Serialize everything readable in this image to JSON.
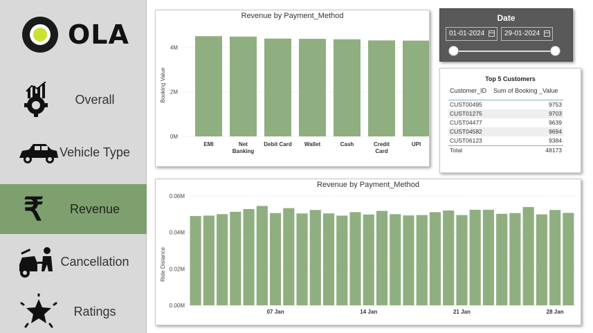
{
  "sidebar": {
    "logo_text": "OLA",
    "items": [
      {
        "label": "Overall",
        "icon": "analytics-gear-icon"
      },
      {
        "label": "Vehicle Type",
        "icon": "car-icon"
      },
      {
        "label": "Revenue",
        "icon": "rupee-icon",
        "active": true
      },
      {
        "label": "Cancellation",
        "icon": "breakdown-icon"
      },
      {
        "label": "Ratings",
        "icon": "star-icon"
      }
    ]
  },
  "colors": {
    "accent": "#7e9f6e",
    "bar": "#8faf80",
    "sidebar_bg": "#d9d9d9",
    "slicer_bg": "#595959"
  },
  "date_slicer": {
    "title": "Date",
    "start": "01-01-2024",
    "end": "29-01-2024"
  },
  "top_customers": {
    "title": "Top 5 Customers",
    "columns": [
      "Customer_ID",
      "Sum of Booking _Value"
    ],
    "rows": [
      [
        "CUST00495",
        "9753"
      ],
      [
        "CUST01275",
        "9703"
      ],
      [
        "CUST04477",
        "9639"
      ],
      [
        "CUST04582",
        "9694"
      ],
      [
        "CUST06123",
        "9384"
      ]
    ],
    "total_label": "Total",
    "total_value": "48173"
  },
  "chart_data": [
    {
      "type": "bar",
      "title": "Revenue by Payment_Method",
      "xlabel": "",
      "ylabel": "Booking Value",
      "categories": [
        "EMI",
        "Net Banking",
        "Debit Card",
        "Wallet",
        "Cash",
        "Credit Card",
        "UPI"
      ],
      "category_lines": [
        [
          "EMI"
        ],
        [
          "Net",
          "Banking"
        ],
        [
          "Debit Card"
        ],
        [
          "Wallet"
        ],
        [
          "Cash"
        ],
        [
          "Credit",
          "Card"
        ],
        [
          "UPI"
        ]
      ],
      "values": [
        4.5,
        4.48,
        4.39,
        4.38,
        4.36,
        4.31,
        4.3
      ],
      "yticks": [
        0,
        2,
        4
      ],
      "ytick_labels": [
        "0M",
        "2M",
        "4M"
      ],
      "ylim": [
        0,
        4.6
      ],
      "unit": "M"
    },
    {
      "type": "bar",
      "title": "Revenue by Payment_Method",
      "xlabel": "",
      "ylabel": "Ride Distance",
      "x_dates": [
        "2024-01-01",
        "2024-01-02",
        "2024-01-03",
        "2024-01-04",
        "2024-01-05",
        "2024-01-06",
        "2024-01-07",
        "2024-01-08",
        "2024-01-09",
        "2024-01-10",
        "2024-01-11",
        "2024-01-12",
        "2024-01-13",
        "2024-01-14",
        "2024-01-15",
        "2024-01-16",
        "2024-01-17",
        "2024-01-18",
        "2024-01-19",
        "2024-01-20",
        "2024-01-21",
        "2024-01-22",
        "2024-01-23",
        "2024-01-24",
        "2024-01-25",
        "2024-01-26",
        "2024-01-27",
        "2024-01-28",
        "2024-01-29"
      ],
      "values": [
        0.049,
        0.0492,
        0.05,
        0.0513,
        0.0528,
        0.0545,
        0.0506,
        0.0533,
        0.0504,
        0.0523,
        0.0504,
        0.0492,
        0.0511,
        0.0498,
        0.0518,
        0.05,
        0.0493,
        0.0495,
        0.0511,
        0.052,
        0.0495,
        0.0524,
        0.0524,
        0.0502,
        0.0506,
        0.0539,
        0.0499,
        0.0523,
        0.0507
      ],
      "xtick_labels": [
        {
          "index": 6,
          "label": "07 Jan"
        },
        {
          "index": 13,
          "label": "14 Jan"
        },
        {
          "index": 20,
          "label": "21 Jan"
        },
        {
          "index": 27,
          "label": "28 Jan"
        }
      ],
      "yticks": [
        0,
        0.02,
        0.04,
        0.06
      ],
      "ytick_labels": [
        "0.00M",
        "0.02M",
        "0.04M",
        "0.06M"
      ],
      "ylim": [
        0,
        0.06
      ]
    }
  ]
}
